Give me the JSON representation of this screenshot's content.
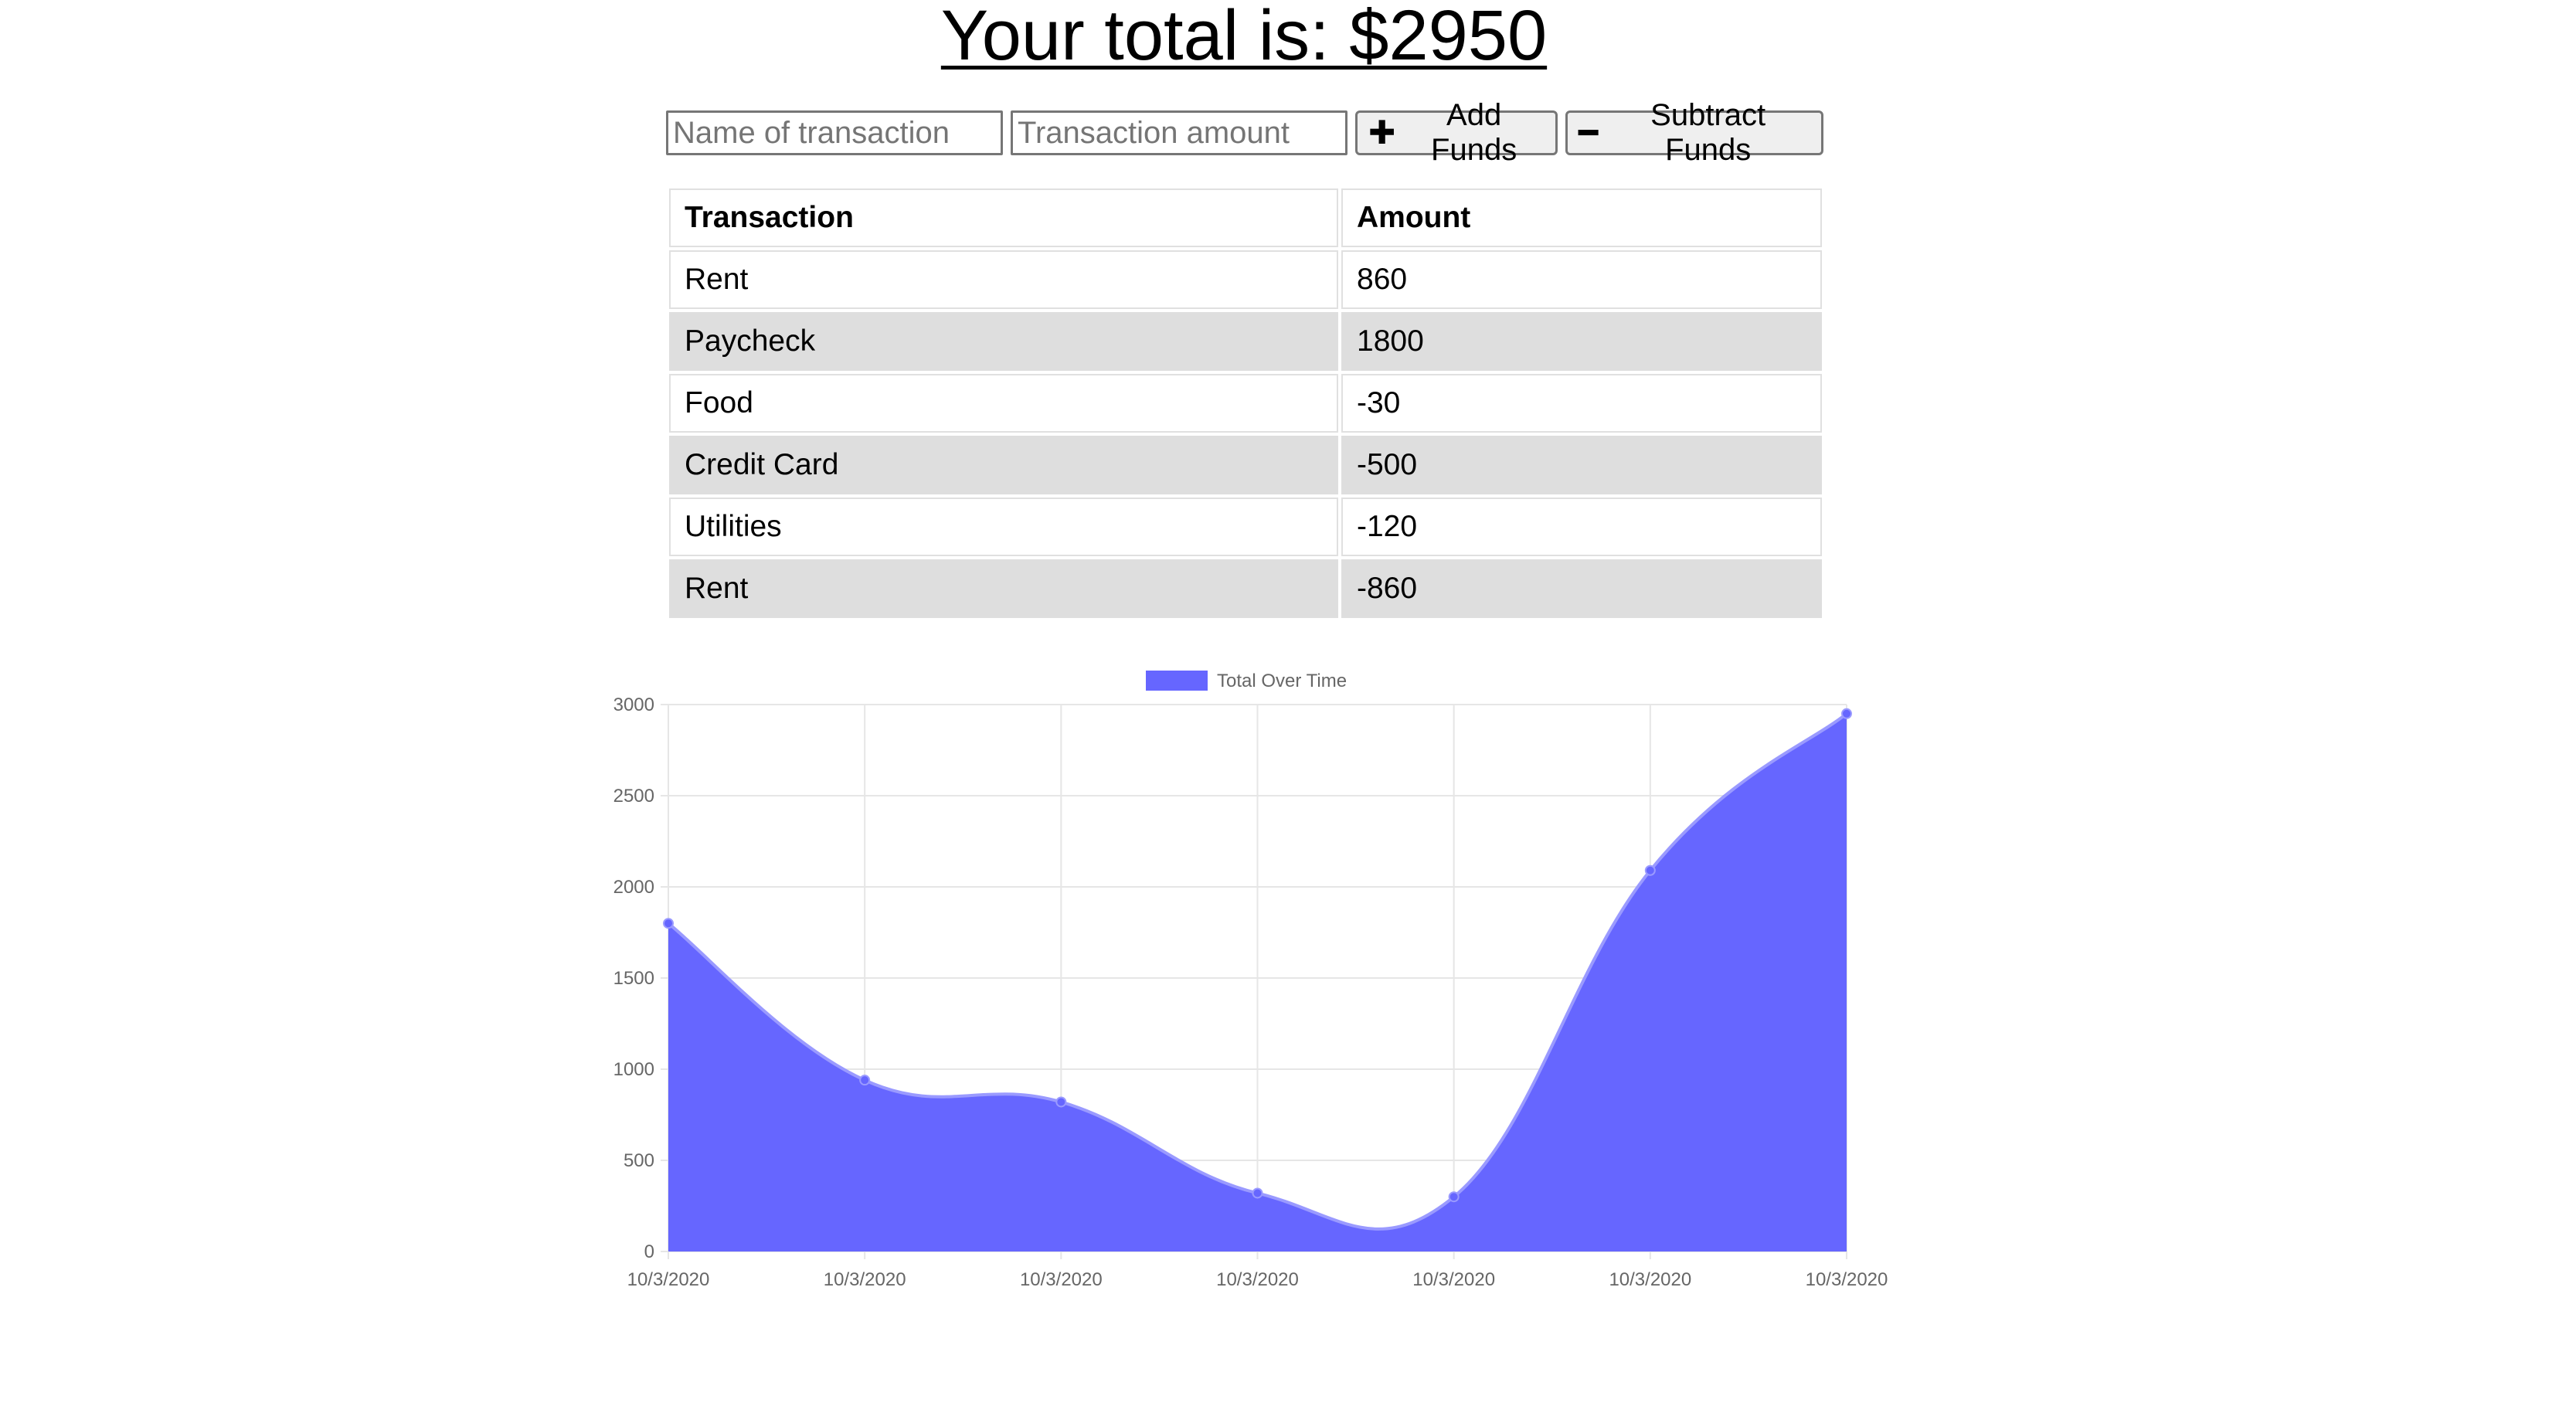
{
  "header": {
    "total_label": "Your total is: $2950"
  },
  "form": {
    "name_placeholder": "Name of transaction",
    "amount_placeholder": "Transaction amount",
    "add_label": "Add Funds",
    "subtract_label": "Subtract Funds",
    "add_icon": "plus-icon",
    "subtract_icon": "minus-icon"
  },
  "table": {
    "headers": [
      "Transaction",
      "Amount"
    ],
    "rows": [
      {
        "name": "Rent",
        "amount": "860"
      },
      {
        "name": "Paycheck",
        "amount": "1800"
      },
      {
        "name": "Food",
        "amount": "-30"
      },
      {
        "name": "Credit Card",
        "amount": "-500"
      },
      {
        "name": "Utilities",
        "amount": "-120"
      },
      {
        "name": "Rent",
        "amount": "-860"
      }
    ]
  },
  "colors": {
    "series_fill": "#6666ff",
    "series_line": "#9a9aff",
    "grid": "#e6e6e6",
    "row_alt": "#dedede"
  },
  "chart_data": {
    "type": "area",
    "title": "",
    "xlabel": "",
    "ylabel": "",
    "legend_position": "top",
    "grid": true,
    "ylim": [
      0,
      3000
    ],
    "y_ticks": [
      0,
      500,
      1000,
      1500,
      2000,
      2500,
      3000
    ],
    "x": [
      "10/3/2020",
      "10/3/2020",
      "10/3/2020",
      "10/3/2020",
      "10/3/2020",
      "10/3/2020",
      "10/3/2020"
    ],
    "series": [
      {
        "name": "Total Over Time",
        "values": [
          1800,
          940,
          820,
          320,
          300,
          2090,
          2950
        ]
      }
    ]
  }
}
